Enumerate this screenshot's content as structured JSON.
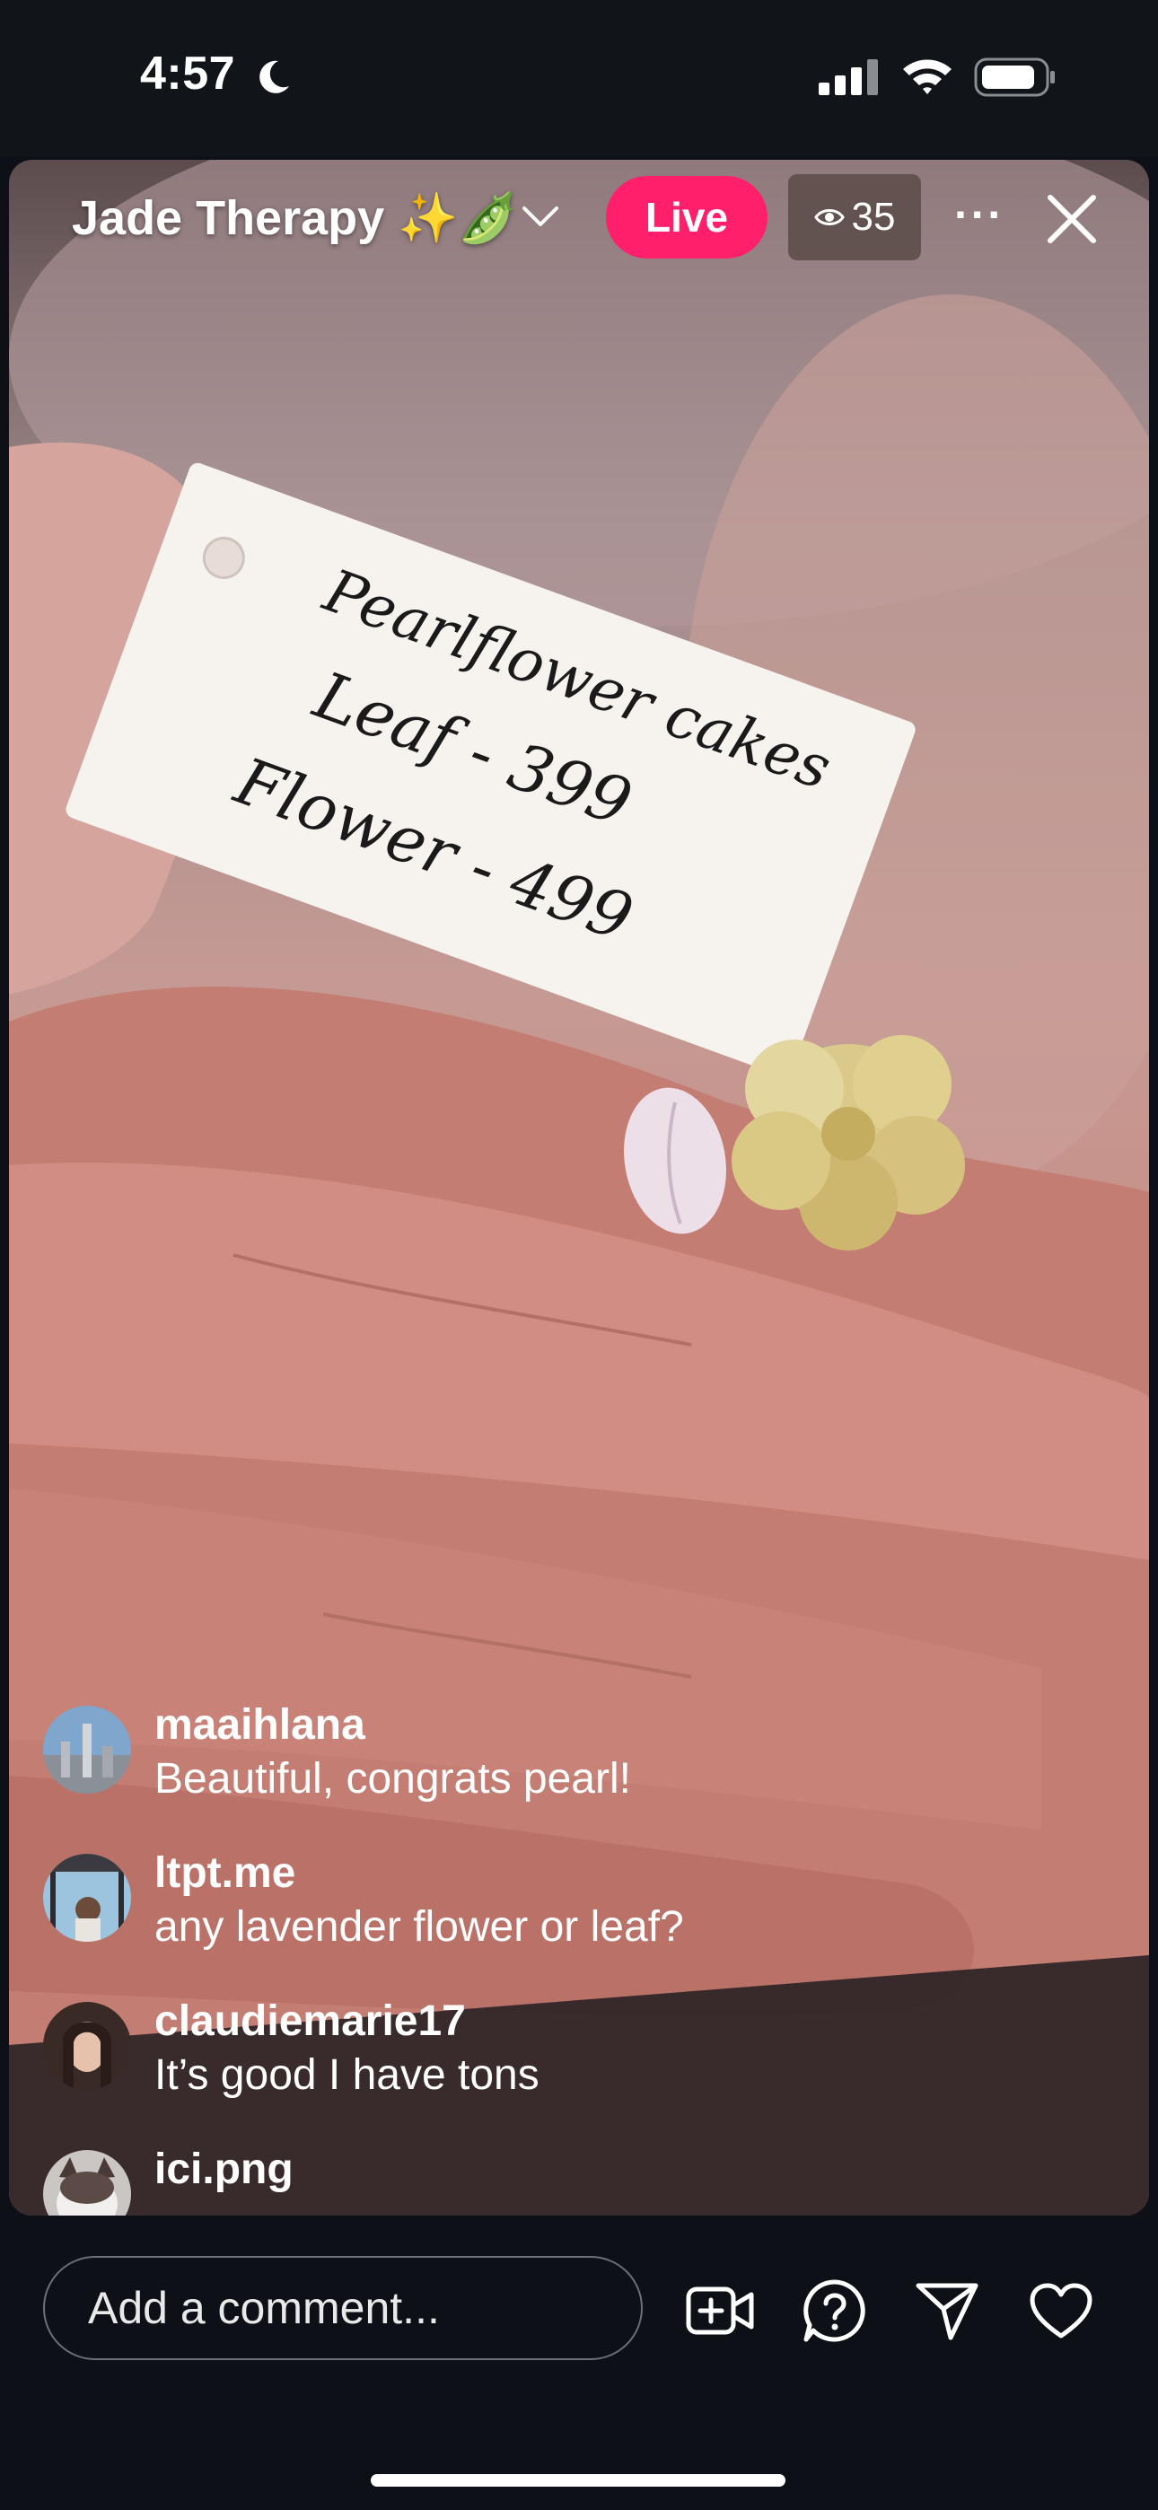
{
  "status_bar": {
    "time": "4:57",
    "icons": [
      "moon-icon",
      "cellular-signal-icon",
      "wifi-icon",
      "battery-icon"
    ]
  },
  "live": {
    "title": "Jade Therapy ✨🫛",
    "live_label": "Live",
    "viewer_count": "35"
  },
  "price_tag": {
    "line1": "Pearlflower cakes",
    "line2": "Leaf - 399",
    "line3": "Flower - 499"
  },
  "comments": [
    {
      "username": "maaihlana",
      "text": "Beautiful, congrats pearl!"
    },
    {
      "username": "ltpt.me",
      "text": "any lavender flower or leaf?"
    },
    {
      "username": "claudiemarie17",
      "text": "It’s good I have tons"
    },
    {
      "username": "ici.png",
      "text": ""
    }
  ],
  "bottom_bar": {
    "comment_placeholder": "Add a comment...",
    "actions": [
      "add-video-icon",
      "question-icon",
      "share-icon",
      "heart-icon"
    ]
  },
  "colors": {
    "live_badge": "#ff1f6b",
    "background": "#0d1117"
  }
}
